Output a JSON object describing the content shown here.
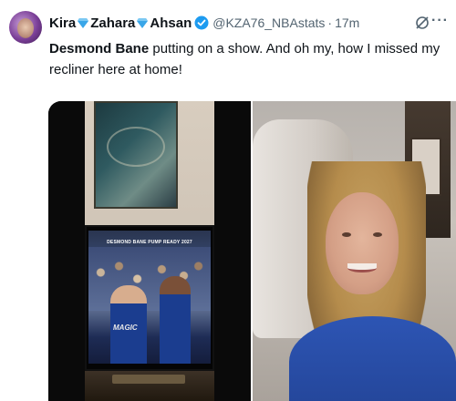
{
  "tweet": {
    "author": {
      "name_parts": [
        "Kira",
        "Zahara",
        "Ahsan"
      ],
      "handle": "@KZA76_NBAstats",
      "separator": "·",
      "time": "17m"
    },
    "menu_label": "···",
    "text_bold": "Desmond Bane",
    "text_rest": " putting on a show. And oh my, how I missed my recliner here at home!",
    "media": {
      "tv_caption": "DESMOND BANE PUMP READY 2027",
      "jersey_text": "MAGIC"
    }
  },
  "icons": {
    "diamond": "gem-icon",
    "verified": "verified-badge-icon",
    "grok": "grok-icon",
    "more": "more-icon"
  },
  "colors": {
    "text": "#0f1419",
    "muted": "#536471",
    "verified": "#1d9bf0",
    "diamond": "#3aa6e8"
  }
}
